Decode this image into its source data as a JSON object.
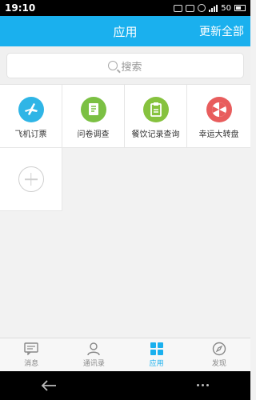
{
  "status_bar": {
    "time": "19:10",
    "battery": "50"
  },
  "header": {
    "title": "应用",
    "action": "更新全部"
  },
  "search": {
    "placeholder": "搜索"
  },
  "apps": [
    {
      "label": "飞机订票",
      "icon": "airplane-icon",
      "color": "#2fb5e6"
    },
    {
      "label": "问卷调查",
      "icon": "survey-icon",
      "color": "#7bc043"
    },
    {
      "label": "餐饮记录查询",
      "icon": "clipboard-icon",
      "color": "#86c23e"
    },
    {
      "label": "幸运大转盘",
      "icon": "wheel-icon",
      "color": "#e85d5d"
    }
  ],
  "add_tile": {
    "icon": "plus-icon"
  },
  "bottom_nav": [
    {
      "label": "消息",
      "icon": "message-icon",
      "active": false
    },
    {
      "label": "通讯录",
      "icon": "contacts-icon",
      "active": false
    },
    {
      "label": "应用",
      "icon": "apps-icon",
      "active": true
    },
    {
      "label": "发现",
      "icon": "compass-icon",
      "active": false
    }
  ],
  "colors": {
    "primary": "#1ab0ee",
    "background": "#f2f2f2"
  }
}
